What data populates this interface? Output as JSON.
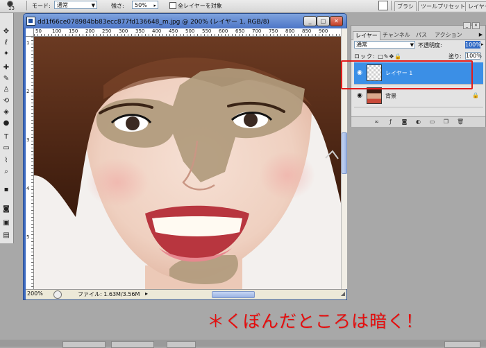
{
  "options_bar": {
    "brush_size": "13",
    "mode_label": "モード:",
    "mode_value": "通常",
    "strength_label": "強さ:",
    "strength_value": "50%",
    "all_layers_label": "全レイヤーを対象",
    "tabs": [
      "ブラシ",
      "ツールプリセット",
      "レイヤー"
    ]
  },
  "document": {
    "title": "dd1f66ce078984bb83ecc877fd136648_m.jpg @ 200% (レイヤー 1, RGB/8)",
    "ruler_top": [
      "50",
      "100",
      "150",
      "200",
      "250",
      "300",
      "350",
      "400",
      "450",
      "500",
      "550",
      "600",
      "650",
      "700",
      "750",
      "800",
      "850",
      "900"
    ],
    "ruler_left": [
      "1",
      "2",
      "3",
      "4",
      "5"
    ],
    "status": {
      "zoom": "200%",
      "file_info": "ファイル: 1.63M/3.56M"
    }
  },
  "layers_panel": {
    "tabs": [
      "レイヤー",
      "チャンネル",
      "パス",
      "アクション"
    ],
    "active_tab": "レイヤー",
    "blend_mode": "通常",
    "opacity_label": "不透明度:",
    "opacity_value": "100%",
    "lock_label": "ロック:",
    "fill_label": "塗り:",
    "fill_value": "100%",
    "layers": [
      {
        "name": "レイヤー 1",
        "selected": true,
        "visible": true,
        "thumbnail": "transparent"
      },
      {
        "name": "背景",
        "selected": false,
        "visible": true,
        "thumbnail": "photo",
        "locked": true
      }
    ]
  },
  "caption": "＊くぼんだところは暗く！",
  "colors": {
    "highlight": "#e11b1b",
    "caption": "#e60d0d",
    "selected_layer": "#3b8fe6",
    "overlay_shadow": "#b09a7c"
  },
  "icons": [
    "brush-icon",
    "move-tool-icon",
    "marquee-tool-icon",
    "lasso-tool-icon",
    "magic-wand-icon",
    "crop-tool-icon",
    "slice-tool-icon",
    "healing-brush-icon",
    "brush-tool-icon",
    "stamp-tool-icon",
    "history-brush-icon",
    "eraser-icon",
    "paint-bucket-icon",
    "dodge-tool-icon",
    "pen-tool-icon",
    "type-tool-icon",
    "shape-tool-icon",
    "eyedropper-icon",
    "hand-tool-icon",
    "zoom-tool-icon",
    "eye-icon",
    "lock-icon"
  ]
}
